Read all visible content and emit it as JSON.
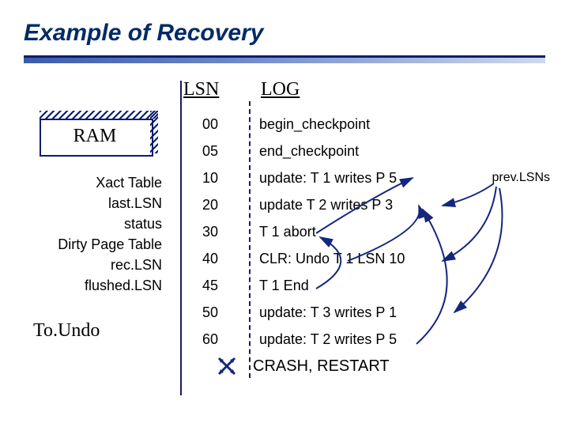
{
  "title": "Example of Recovery",
  "headers": {
    "lsn": "LSN",
    "log": "LOG"
  },
  "ram": {
    "label": "RAM"
  },
  "left": {
    "items": [
      "Xact Table",
      "last.LSN",
      "status",
      "Dirty Page Table",
      "rec.LSN",
      "flushed.LSN"
    ]
  },
  "toundo": "To.Undo",
  "rows": [
    {
      "lsn": "00",
      "text": "begin_checkpoint"
    },
    {
      "lsn": "05",
      "text": "end_checkpoint"
    },
    {
      "lsn": "10",
      "text": "update: T 1 writes P 5"
    },
    {
      "lsn": "20",
      "text": "update T 2 writes P 3"
    },
    {
      "lsn": "30",
      "text": "T 1 abort"
    },
    {
      "lsn": "40",
      "text": "CLR: Undo T 1 LSN 10"
    },
    {
      "lsn": "45",
      "text": "T 1 End"
    },
    {
      "lsn": "50",
      "text": "update: T 3 writes P 1"
    },
    {
      "lsn": "60",
      "text": "update: T 2 writes P 5"
    }
  ],
  "crash": "CRASH, RESTART",
  "annotation": "prev.LSNs",
  "colors": {
    "accent": "#0b1d6e",
    "arrow": "#14267d"
  }
}
